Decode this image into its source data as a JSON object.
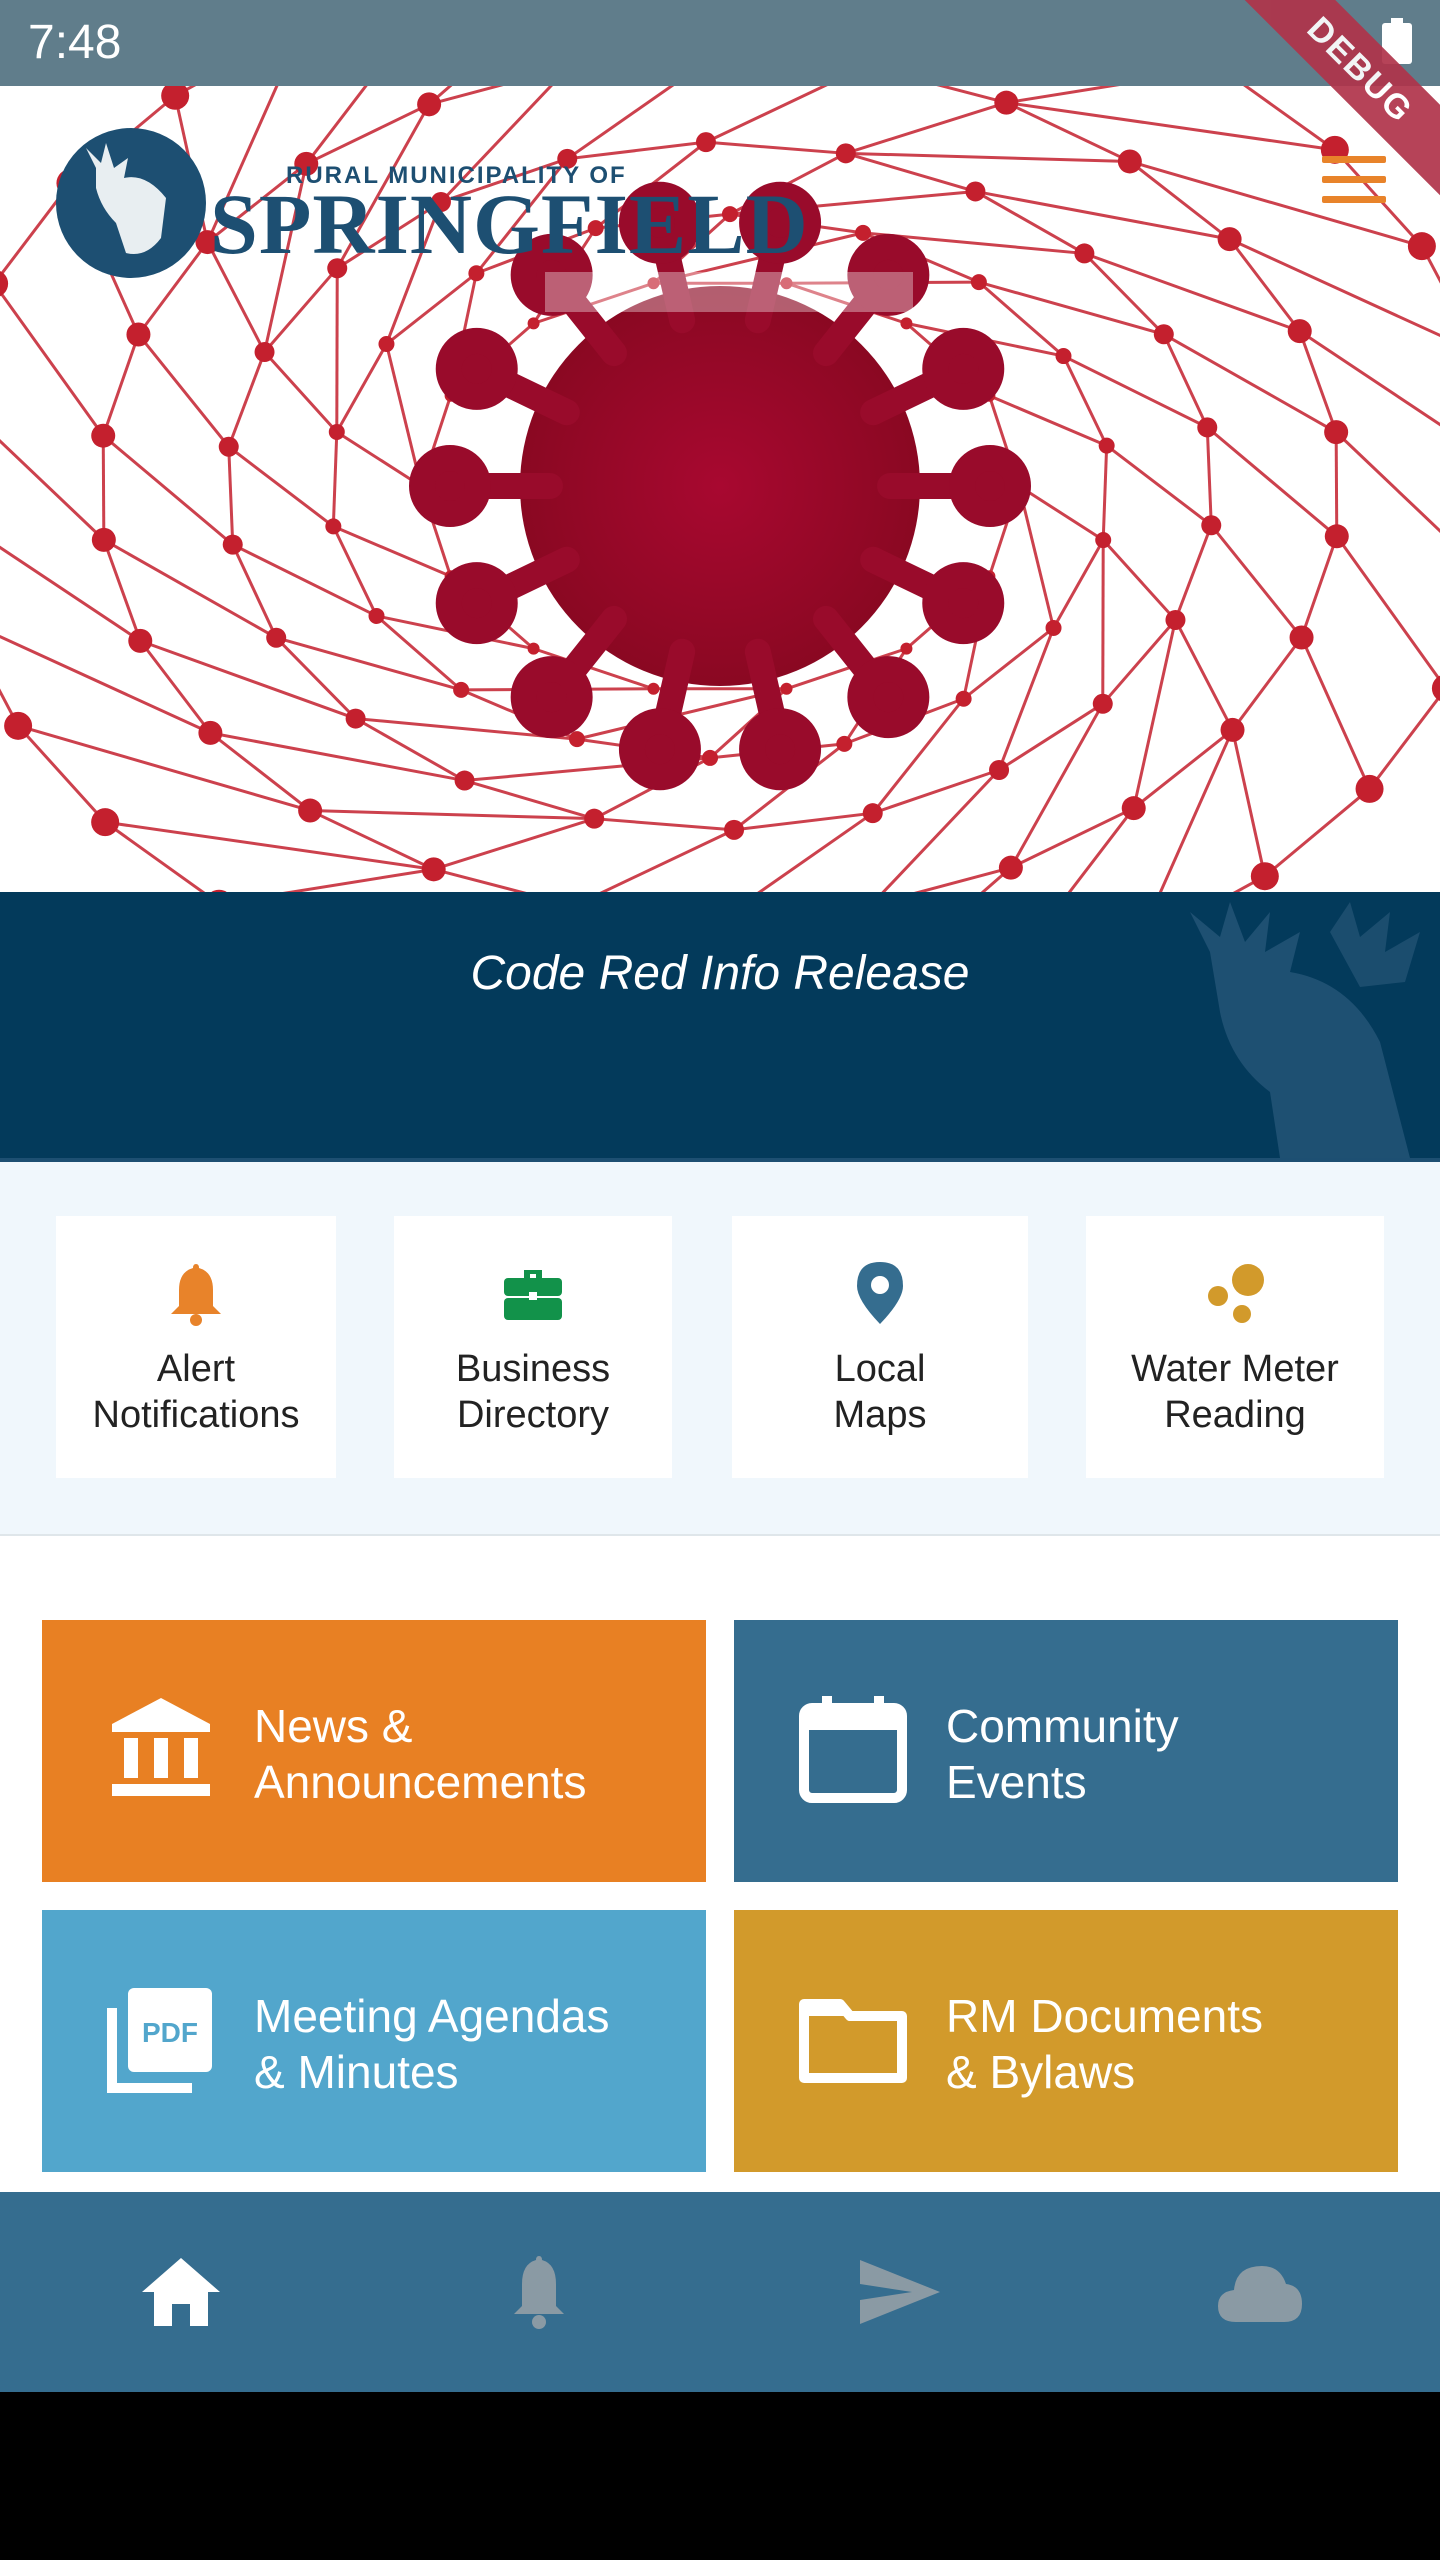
{
  "status_bar": {
    "time": "7:48",
    "debug_label": "DEBUG"
  },
  "header": {
    "logo_small_text": "RURAL MUNICIPALITY OF",
    "logo_big_text": "SPRINGFIELD",
    "menu_icon": "hamburger-menu-icon"
  },
  "alert_banner": {
    "title": "Code Red Info Release"
  },
  "quick_links": [
    {
      "label": "Alert\nNotifications",
      "icon": "bell-icon",
      "color": "#e8832a"
    },
    {
      "label": "Business\nDirectory",
      "icon": "briefcase-icon",
      "color": "#12924a"
    },
    {
      "label": "Local\nMaps",
      "icon": "map-pin-icon",
      "color": "#356d8f"
    },
    {
      "label": "Water Meter\nReading",
      "icon": "droplets-icon",
      "color": "#d29a2b"
    }
  ],
  "tiles": [
    {
      "label": "News &\nAnnouncements",
      "icon": "bank-icon",
      "color": "#e88023"
    },
    {
      "label": "Community\nEvents",
      "icon": "calendar-icon",
      "color": "#356d8f"
    },
    {
      "label": "Meeting Agendas\n& Minutes",
      "icon": "pdf-icon",
      "color": "#52a6cc"
    },
    {
      "label": "RM Documents\n& Bylaws",
      "icon": "folder-icon",
      "color": "#d29a2b"
    }
  ],
  "bottom_nav": [
    {
      "icon": "home-icon",
      "active": true
    },
    {
      "icon": "bell-icon",
      "active": false
    },
    {
      "icon": "send-icon",
      "active": false
    },
    {
      "icon": "cloud-icon",
      "active": false
    }
  ],
  "colors": {
    "status_bar": "#607d8b",
    "banner": "#033a5b",
    "accent_orange": "#e8832a",
    "nav_bg": "#356d8f",
    "nav_active": "#ffffff",
    "nav_inactive": "#8a9aa4"
  }
}
